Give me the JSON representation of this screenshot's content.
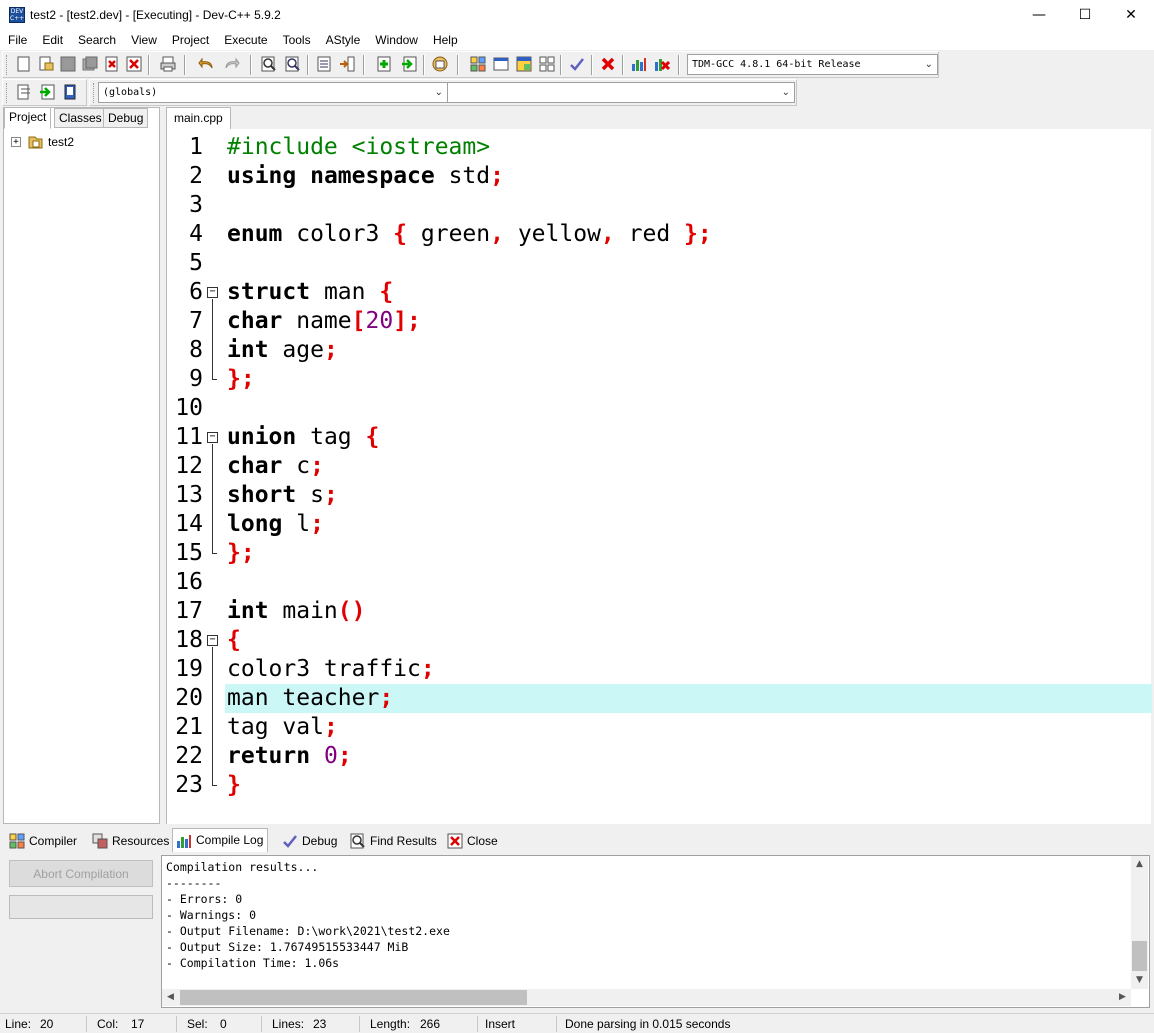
{
  "window": {
    "title": "test2 - [test2.dev] - [Executing] - Dev-C++ 5.9.2",
    "app_icon_text": "DEV C++",
    "minimize": "—",
    "maximize": "☐",
    "close": "✕"
  },
  "menu": [
    "File",
    "Edit",
    "Search",
    "View",
    "Project",
    "Execute",
    "Tools",
    "AStyle",
    "Window",
    "Help"
  ],
  "toolbar": {
    "compiler_select": "TDM-GCC 4.8.1 64-bit Release",
    "scope_select": "(globals)",
    "function_select": ""
  },
  "left_panel": {
    "tabs": [
      "Project",
      "Classes",
      "Debug"
    ],
    "active_tab": "Project",
    "tree": {
      "expander": "+",
      "project_name": "test2"
    }
  },
  "editor": {
    "tab": "main.cpp",
    "highlighted_line": 20,
    "lines": [
      {
        "n": "1"
      },
      {
        "n": "2"
      },
      {
        "n": "3"
      },
      {
        "n": "4"
      },
      {
        "n": "5"
      },
      {
        "n": "6"
      },
      {
        "n": "7"
      },
      {
        "n": "8"
      },
      {
        "n": "9"
      },
      {
        "n": "10"
      },
      {
        "n": "11"
      },
      {
        "n": "12"
      },
      {
        "n": "13"
      },
      {
        "n": "14"
      },
      {
        "n": "15"
      },
      {
        "n": "16"
      },
      {
        "n": "17"
      },
      {
        "n": "18"
      },
      {
        "n": "19"
      },
      {
        "n": "20"
      },
      {
        "n": "21"
      },
      {
        "n": "22"
      },
      {
        "n": "23"
      }
    ],
    "tokens": {
      "l1_pp": "#include <iostream>",
      "l2_using": "using",
      "l2_namespace": "namespace",
      "l2_std": " std",
      "l2_semi": ";",
      "l4_enum": "enum",
      "l4_rest": " color3 ",
      "l4_lb": "{",
      "l4_green": " green",
      "l4_c1": ",",
      "l4_yellow": " yellow",
      "l4_c2": ",",
      "l4_red": " red ",
      "l4_rb": "};",
      "l6_struct": "struct",
      "l6_man": " man ",
      "l6_lb": "{",
      "l7_char": "char",
      "l7_name": " name",
      "l7_lbr": "[",
      "l7_20": "20",
      "l7_rbr": "];",
      "l8_int": "int",
      "l8_age": " age",
      "l8_semi": ";",
      "l9_rb": "};",
      "l11_union": "union",
      "l11_tag": " tag ",
      "l11_lb": "{",
      "l12_char": "char",
      "l12_c": " c",
      "l12_semi": ";",
      "l13_short": "short",
      "l13_s": " s",
      "l13_semi": ";",
      "l14_long": "long",
      "l14_l": " l",
      "l14_semi": ";",
      "l15_rb": "};",
      "l17_int": "int",
      "l17_main": " main",
      "l17_paren": "()",
      "l18_lb": "{",
      "l19_text": "color3 traffic",
      "l19_semi": ";",
      "l20_text": "man teacher",
      "l20_semi": ";",
      "l21_text": "tag val",
      "l21_semi": ";",
      "l22_return": "return",
      "l22_zero": "0",
      "l22_semi": ";",
      "l23_rb": "}"
    },
    "fold_marker": "−"
  },
  "bottom_panel": {
    "tabs": [
      {
        "label": "Compiler",
        "icon": "grid-icon"
      },
      {
        "label": "Resources",
        "icon": "resources-icon"
      },
      {
        "label": "Compile Log",
        "icon": "chart-icon"
      },
      {
        "label": "Debug",
        "icon": "check-icon"
      },
      {
        "label": "Find Results",
        "icon": "find-icon"
      },
      {
        "label": "Close",
        "icon": "close-panel-icon"
      }
    ],
    "active_tab": "Compile Log",
    "abort_button": "Abort Compilation",
    "log": [
      "Compilation results...",
      "--------",
      "- Errors: 0",
      "- Warnings: 0",
      "- Output Filename: D:\\work\\2021\\test2.exe",
      "- Output Size: 1.76749515533447 MiB",
      "- Compilation Time: 1.06s"
    ]
  },
  "status": {
    "line_label": "Line:",
    "line_val": "20",
    "col_label": "Col:",
    "col_val": "17",
    "sel_label": "Sel:",
    "sel_val": "0",
    "lines_label": "Lines:",
    "lines_val": "23",
    "length_label": "Length:",
    "length_val": "266",
    "mode": "Insert",
    "message": "Done parsing in 0.015 seconds"
  },
  "colors": {
    "keyword": "#000000",
    "preprocessor": "#008000",
    "symbol": "#e00000",
    "number": "#800080",
    "current_line": "#ccf7f7"
  }
}
